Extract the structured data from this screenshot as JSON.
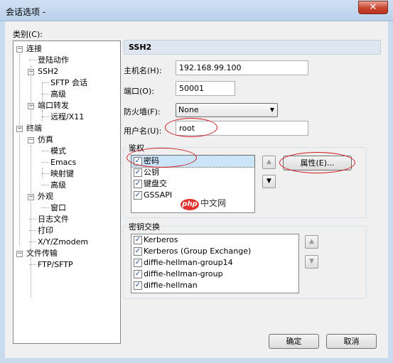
{
  "window": {
    "title": "会话选项 -",
    "close": "✕"
  },
  "category_label": "类别(C):",
  "tree": [
    {
      "id": "conn",
      "label": "连接",
      "level": 0,
      "expander": "−"
    },
    {
      "id": "login",
      "label": "登陆动作",
      "level": 1
    },
    {
      "id": "ssh2",
      "label": "SSH2",
      "level": 1,
      "expander": "−"
    },
    {
      "id": "sftp",
      "label": "SFTP 会话",
      "level": 2
    },
    {
      "id": "adv1",
      "label": "高级",
      "level": 2
    },
    {
      "id": "fwd",
      "label": "端口转发",
      "level": 1,
      "expander": "−"
    },
    {
      "id": "x11",
      "label": "远程/X11",
      "level": 2
    },
    {
      "id": "term",
      "label": "终端",
      "level": 0,
      "expander": "−"
    },
    {
      "id": "emu",
      "label": "仿真",
      "level": 1,
      "expander": "−"
    },
    {
      "id": "mode",
      "label": "模式",
      "level": 2
    },
    {
      "id": "emacs",
      "label": "Emacs",
      "level": 2
    },
    {
      "id": "map",
      "label": "映射键",
      "level": 2
    },
    {
      "id": "adv2",
      "label": "高级",
      "level": 2
    },
    {
      "id": "look",
      "label": "外观",
      "level": 1,
      "expander": "−"
    },
    {
      "id": "window",
      "label": "窗口",
      "level": 2
    },
    {
      "id": "log",
      "label": "日志文件",
      "level": 1
    },
    {
      "id": "print",
      "label": "打印",
      "level": 1
    },
    {
      "id": "xyz",
      "label": "X/Y/Zmodem",
      "level": 1
    },
    {
      "id": "xfer",
      "label": "文件传输",
      "level": 0,
      "expander": "−"
    },
    {
      "id": "ftp",
      "label": "FTP/SFTP",
      "level": 1
    }
  ],
  "section_title": "SSH2",
  "host": {
    "label": "主机名(H):",
    "value": "192.168.99.100"
  },
  "port": {
    "label": "端口(O):",
    "value": "50001"
  },
  "firewall": {
    "label": "防火墙(F):",
    "value": "None"
  },
  "username": {
    "label": "用户名(U):",
    "value": "root"
  },
  "auth": {
    "title": "鉴权",
    "items": [
      {
        "label": "密码",
        "checked": true
      },
      {
        "label": "公钥",
        "checked": true
      },
      {
        "label": "键盘交",
        "checked": true
      },
      {
        "label": "GSSAPI",
        "checked": true
      }
    ],
    "properties_button": "属性(E)..."
  },
  "kex": {
    "title": "密钥交换",
    "items": [
      {
        "label": "Kerberos",
        "checked": true
      },
      {
        "label": "Kerberos (Group Exchange)",
        "checked": true
      },
      {
        "label": "diffie-hellman-group14",
        "checked": true
      },
      {
        "label": "diffie-hellman-group",
        "checked": true
      },
      {
        "label": "diffie-hellman",
        "checked": true
      }
    ]
  },
  "buttons": {
    "ok": "确定",
    "cancel": "取消"
  },
  "watermark": {
    "logo": "php",
    "text": "中文网"
  },
  "icons": {
    "check": "✓",
    "up": "▲",
    "down": "▼",
    "dropdown": "▼"
  },
  "colors": {
    "annotation": "#d0181d"
  }
}
